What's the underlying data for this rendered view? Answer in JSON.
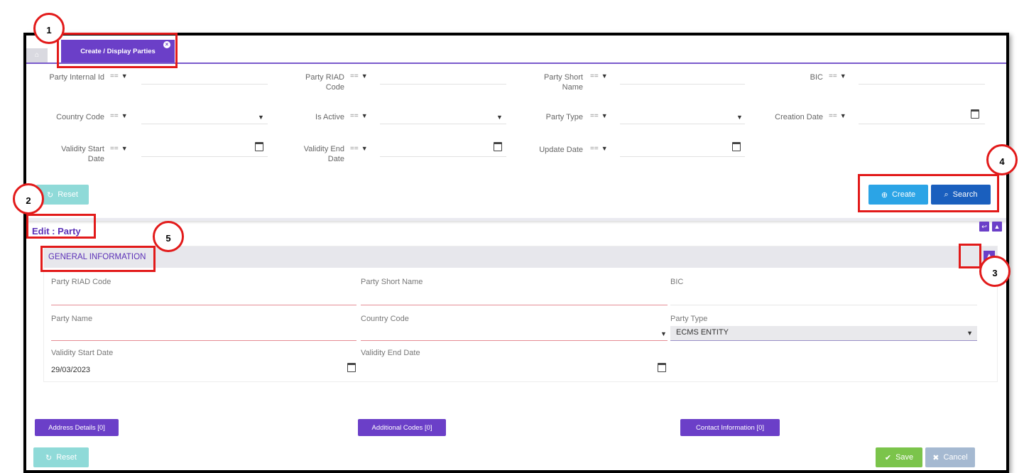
{
  "tabs": {
    "home_label": "",
    "active_label": "Create / Display Parties",
    "close_glyph": "x"
  },
  "filters": {
    "operator": "==",
    "row1": [
      {
        "label_line1": "Party Internal Id",
        "label_line2": ""
      },
      {
        "label_line1": "Party RIAD",
        "label_line2": "Code"
      },
      {
        "label_line1": "Party Short",
        "label_line2": "Name"
      },
      {
        "label_line1": "BIC",
        "label_line2": ""
      }
    ],
    "row2": [
      {
        "label_line1": "Country Code",
        "label_line2": ""
      },
      {
        "label_line1": "Is Active",
        "label_line2": ""
      },
      {
        "label_line1": "Party Type",
        "label_line2": ""
      },
      {
        "label_line1": "Creation Date",
        "label_line2": ""
      }
    ],
    "row3": [
      {
        "label_line1": "Validity Start",
        "label_line2": "Date"
      },
      {
        "label_line1": "Validity End",
        "label_line2": "Date"
      },
      {
        "label_line1": "Update Date",
        "label_line2": ""
      }
    ]
  },
  "buttons": {
    "reset": "Reset",
    "create": "Create",
    "search": "Search",
    "save": "Save",
    "cancel": "Cancel"
  },
  "edit": {
    "title": "Edit : Party",
    "section_title": "GENERAL INFORMATION",
    "fields": {
      "riad_code": "Party RIAD Code",
      "short_name": "Party Short Name",
      "bic": "BIC",
      "party_name": "Party Name",
      "country_code": "Country Code",
      "party_type": "Party Type",
      "party_type_value": "ECMS ENTITY",
      "validity_start": "Validity Start Date",
      "validity_start_value": "29/03/2023",
      "validity_end": "Validity End Date"
    },
    "sub_buttons": {
      "address": "Address Details [0]",
      "codes": "Additional Codes [0]",
      "contact": "Contact Information [0]"
    }
  },
  "annotations": [
    "1",
    "2",
    "3",
    "4",
    "5"
  ],
  "colors": {
    "accent": "#6b3fc8",
    "create": "#2ba4e6",
    "search": "#1a5fbe",
    "save": "#7bc44b",
    "annotation": "#e21a1a"
  }
}
